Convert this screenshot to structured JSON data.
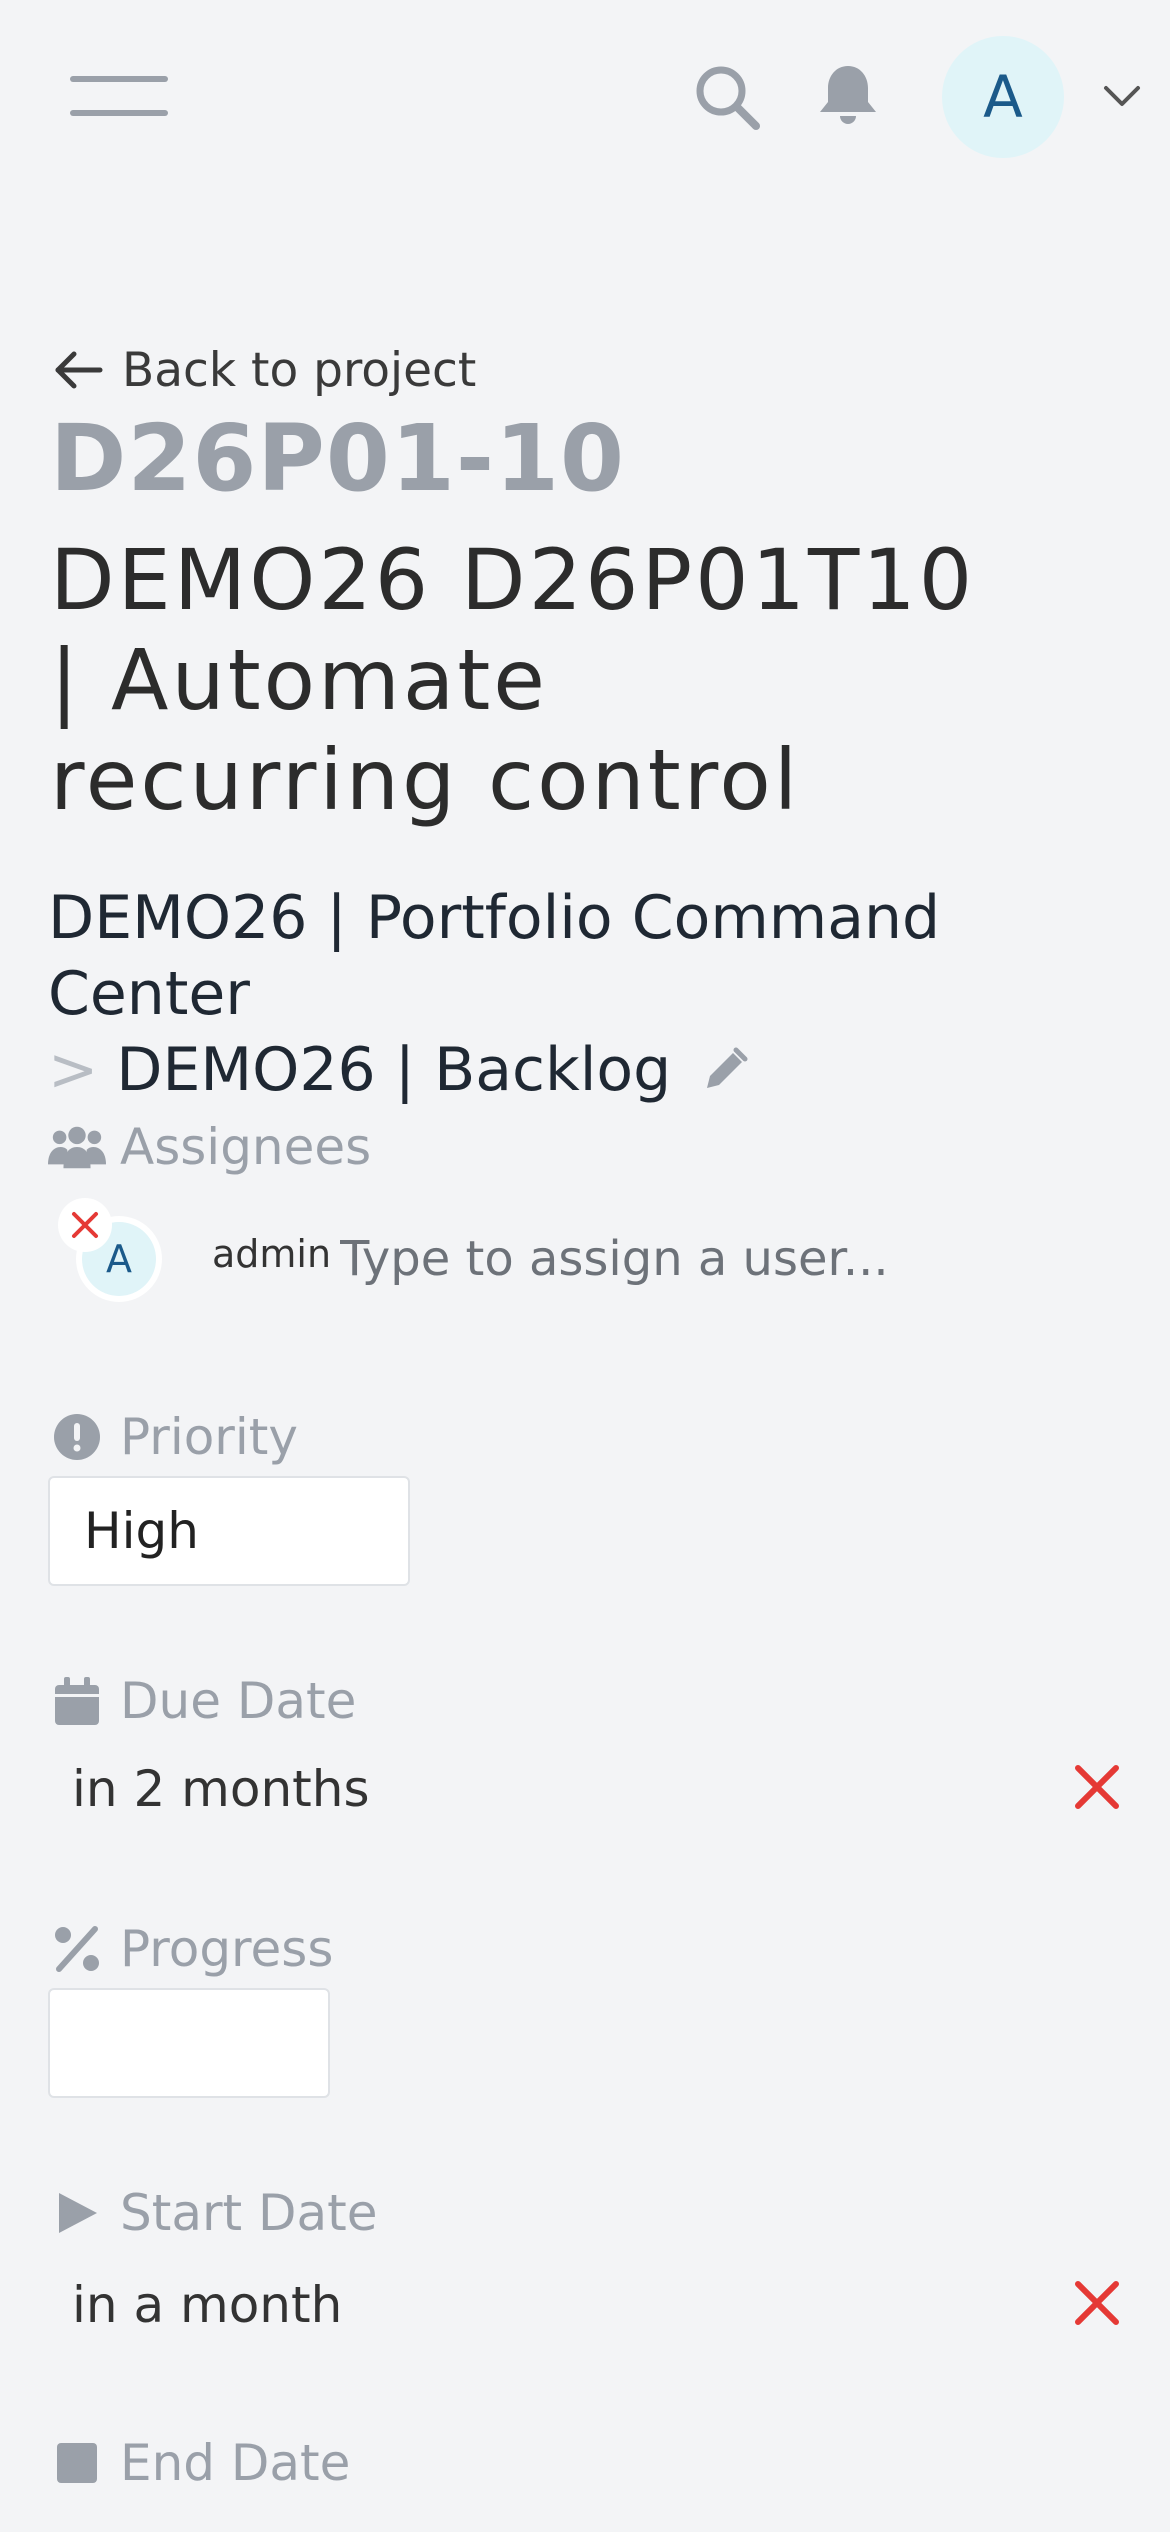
{
  "header": {
    "user_initial": "A"
  },
  "back": {
    "label": "Back to project"
  },
  "task": {
    "key": "D26P01-10",
    "title_line1": "DEMO26 D26P01T10",
    "title_line2": "| Automate",
    "title_line3": "recurring control"
  },
  "breadcrumb": {
    "project": "DEMO26 | Portfolio Command Center",
    "separator": ">",
    "bucket": "DEMO26 | Backlog"
  },
  "assignees": {
    "label": "Assignees",
    "items": [
      {
        "initial": "A",
        "name": "admin"
      }
    ],
    "input_placeholder": "Type to assign a user..."
  },
  "priority": {
    "label": "Priority",
    "value": "High"
  },
  "due_date": {
    "label": "Due Date",
    "value": "in 2 months"
  },
  "progress": {
    "label": "Progress",
    "value": ""
  },
  "start_date": {
    "label": "Start Date",
    "value": "in a month"
  },
  "end_date": {
    "label": "End Date"
  },
  "colors": {
    "background": "#f3f4f6",
    "muted": "#9aa0a9",
    "danger": "#e53935",
    "avatar_bg": "#e0f4f8",
    "avatar_text": "#1b5a8a"
  }
}
